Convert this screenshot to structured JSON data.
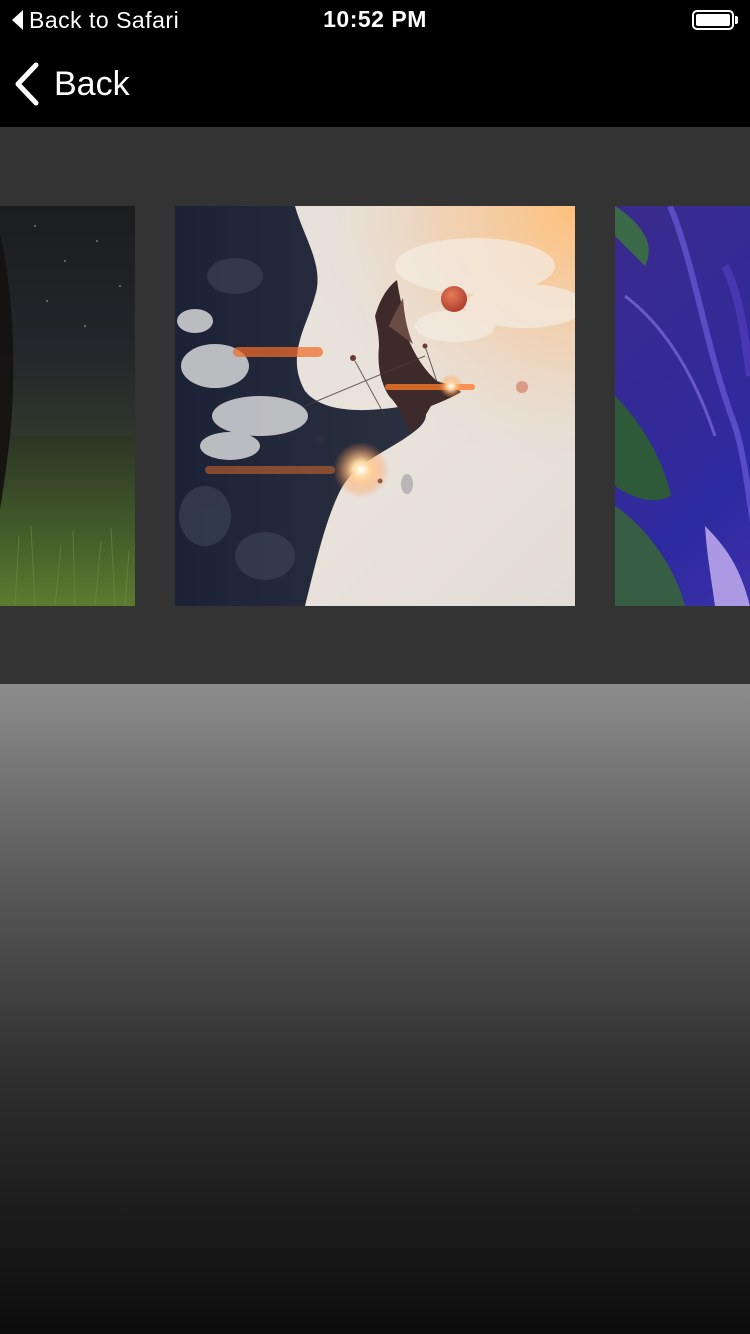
{
  "status_bar": {
    "back_label": "Back to Safari",
    "time": "10:52 PM",
    "battery_icon": "battery-full-icon"
  },
  "nav_bar": {
    "back_label": "Back",
    "back_icon": "chevron-left-icon"
  },
  "carousel": {
    "background": "#333333",
    "slides": [
      {
        "name": "night-field-image",
        "position": "left-partial"
      },
      {
        "name": "eagle-sky-artwork-image",
        "position": "center"
      },
      {
        "name": "purple-abstract-image",
        "position": "right-partial"
      }
    ]
  },
  "colors": {
    "bar": "#000000",
    "carousel": "#333333",
    "gradient_top": "#8c8c8c",
    "gradient_bottom": "#0c0c0c"
  }
}
